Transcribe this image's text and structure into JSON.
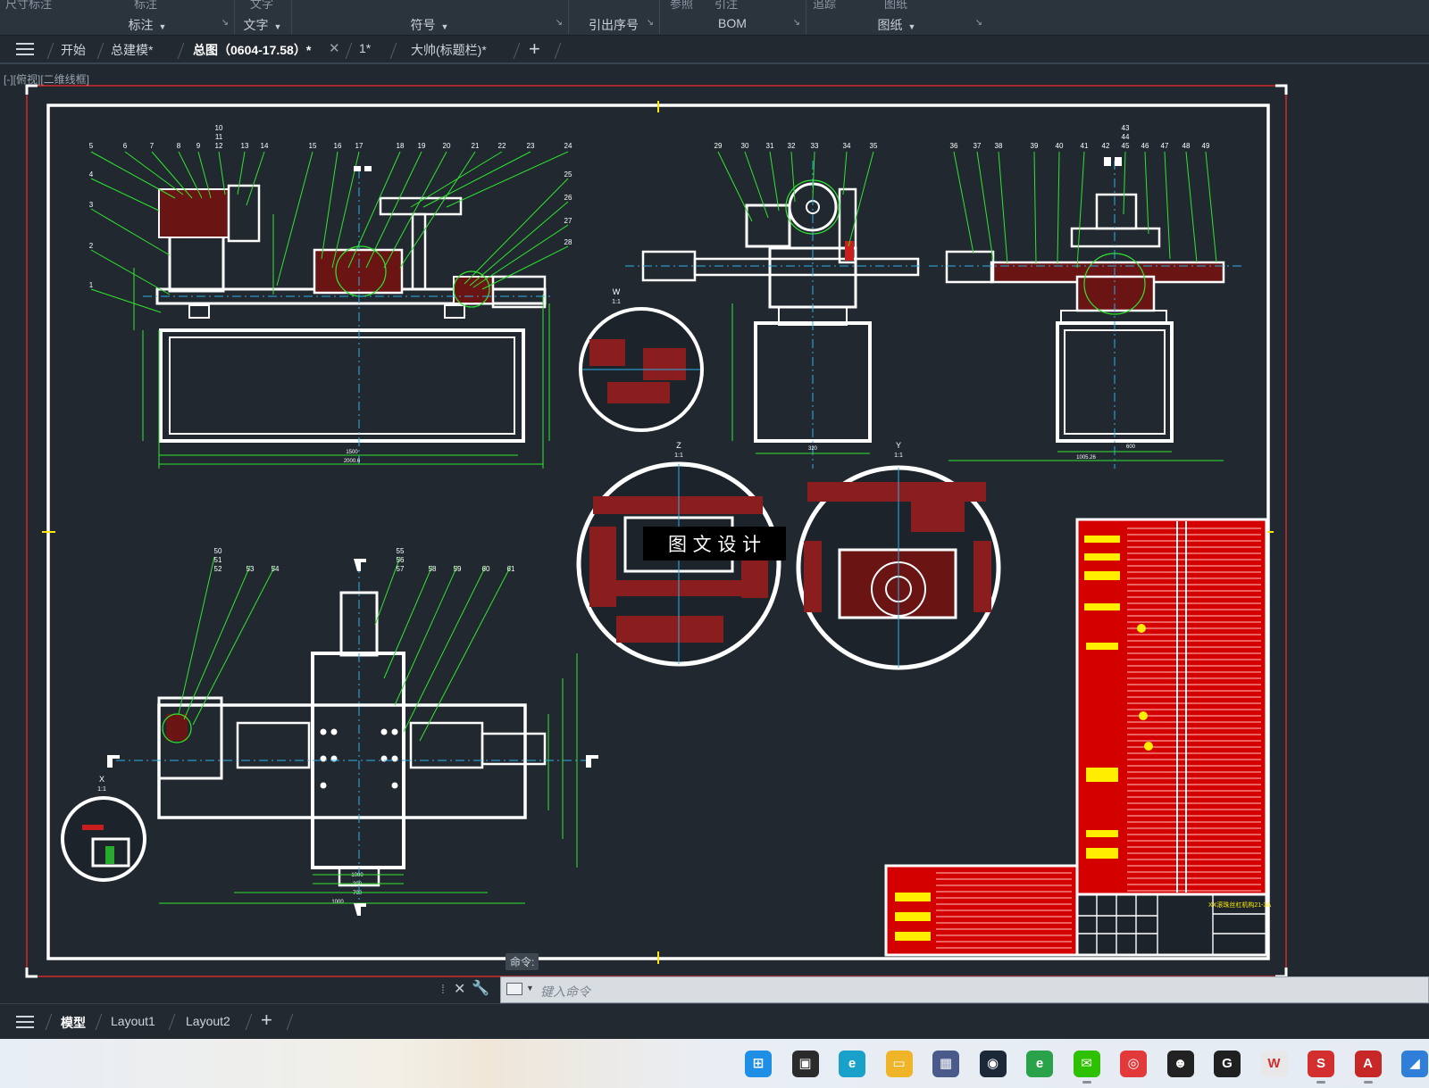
{
  "ribbon": {
    "top_row_fragments": [
      "尺寸标注",
      "标注",
      "文字",
      "参照",
      "引注",
      "追踪",
      "图纸"
    ],
    "panels": [
      {
        "label": "标注",
        "has_caret": true
      },
      {
        "label": "文字",
        "has_caret": true
      },
      {
        "label": "符号",
        "has_caret": true
      },
      {
        "label": "引出序号",
        "has_caret": false
      },
      {
        "label": "BOM",
        "has_caret": false
      },
      {
        "label": "图纸",
        "has_caret": true
      }
    ]
  },
  "file_tabs": [
    {
      "label": "开始",
      "active": false,
      "closable": false
    },
    {
      "label": "总建模*",
      "active": false,
      "closable": false
    },
    {
      "label": "总图（0604-17.58）*",
      "active": true,
      "closable": true
    },
    {
      "label": "1*",
      "active": false,
      "closable": false
    },
    {
      "label": "大帅(标题栏)*",
      "active": false,
      "closable": false
    }
  ],
  "viewport_label": "[-][俯视][二维线框]",
  "drawing": {
    "watermark": "图 文 设 计",
    "leader_numbers_top_left": [
      "5",
      "6",
      "7",
      "8",
      "9",
      "10",
      "11",
      "12",
      "13",
      "14",
      "15",
      "16",
      "17",
      "18",
      "19",
      "20",
      "21",
      "22",
      "23",
      "24",
      "25",
      "26",
      "27",
      "28",
      "4",
      "3",
      "2",
      "1"
    ],
    "leader_numbers_top_mid": [
      "29",
      "30",
      "31",
      "32",
      "33",
      "34",
      "35"
    ],
    "leader_numbers_top_right": [
      "36",
      "37",
      "38",
      "39",
      "40",
      "41",
      "42",
      "43",
      "44",
      "45",
      "46",
      "47",
      "48",
      "49"
    ],
    "leader_numbers_bottom": [
      "50",
      "51",
      "52",
      "53",
      "54",
      "55",
      "56",
      "57",
      "58",
      "59",
      "60",
      "61"
    ],
    "detail_views": [
      "W",
      "Z",
      "Y",
      "X"
    ],
    "detail_scale": "1:1",
    "dimensions": [
      "1500",
      "2000.6",
      "320",
      "600",
      "1005.26",
      "1000",
      "700",
      "398",
      "1000"
    ],
    "title_block_text": "XX滚珠丝杠机构21-3A"
  },
  "command": {
    "tooltip": "命令:",
    "placeholder": "键入命令"
  },
  "layout_tabs": [
    {
      "label": "模型",
      "active": true
    },
    {
      "label": "Layout1",
      "active": false
    },
    {
      "label": "Layout2",
      "active": false
    }
  ],
  "taskbar": {
    "apps": [
      {
        "name": "windows-start",
        "color": "#1f8fe5",
        "glyph": "⊞"
      },
      {
        "name": "task-view",
        "color": "#2b2b2b",
        "glyph": "▣"
      },
      {
        "name": "edge",
        "color": "#1aa1c9",
        "glyph": "e"
      },
      {
        "name": "file-explorer",
        "color": "#f0b429",
        "glyph": "▭"
      },
      {
        "name": "app-grid",
        "color": "#4a5a8a",
        "glyph": "▦"
      },
      {
        "name": "steam",
        "color": "#1b2838",
        "glyph": "◉"
      },
      {
        "name": "browser-360",
        "color": "#2aa24a",
        "glyph": "e"
      },
      {
        "name": "wechat",
        "color": "#2dc100",
        "glyph": "✉"
      },
      {
        "name": "netease-music",
        "color": "#e23a3a",
        "glyph": "◎"
      },
      {
        "name": "qq",
        "color": "#222222",
        "glyph": "☻"
      },
      {
        "name": "app-g",
        "color": "#202020",
        "glyph": "G"
      },
      {
        "name": "wps",
        "color": "#e8e8e8",
        "glyph": "W"
      },
      {
        "name": "solidworks-2023",
        "color": "#d32f2f",
        "glyph": "S"
      },
      {
        "name": "autocad-mechanical",
        "color": "#c62828",
        "glyph": "A"
      },
      {
        "name": "app-blue",
        "color": "#2f7fd8",
        "glyph": "◢"
      }
    ]
  },
  "colors": {
    "background": "#212830",
    "drawing_border": "#ffffff",
    "dimension": "#2ee62e",
    "hatch": "#c81e1e",
    "centerline": "#2ab0e8",
    "sheet_border": "#ff2b2b",
    "title_block": "#dd0000",
    "title_text": "#ffee00"
  }
}
